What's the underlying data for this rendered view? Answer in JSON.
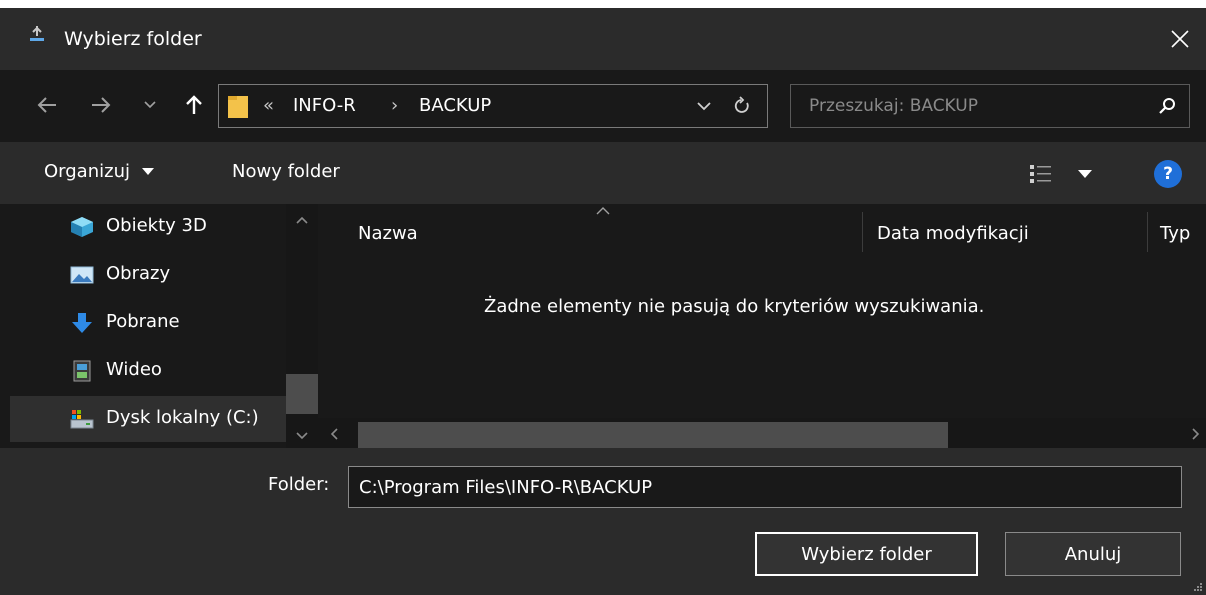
{
  "window": {
    "title": "Wybierz folder",
    "close_glyph": "✕"
  },
  "nav": {
    "back_icon": "arrow-left-icon",
    "forward_icon": "arrow-right-icon",
    "recent_icon": "chevron-down-icon",
    "up_icon": "arrow-up-icon",
    "breadcrumb_prefix": "«",
    "breadcrumb": [
      "INFO-R",
      "BACKUP"
    ],
    "breadcrumb_sep": "›",
    "search_placeholder": "Przeszukaj: BACKUP"
  },
  "toolbar": {
    "organize_label": "Organizuj",
    "new_folder_label": "Nowy folder",
    "help_glyph": "?"
  },
  "sidebar": {
    "items": [
      {
        "label": "Obiekty 3D",
        "icon": "3d-objects-icon"
      },
      {
        "label": "Obrazy",
        "icon": "pictures-icon"
      },
      {
        "label": "Pobrane",
        "icon": "downloads-icon"
      },
      {
        "label": "Wideo",
        "icon": "video-icon"
      },
      {
        "label": "Dysk lokalny (C:)",
        "icon": "local-disk-icon",
        "selected": true
      }
    ]
  },
  "content": {
    "columns": [
      "Nazwa",
      "Data modyfikacji",
      "Typ"
    ],
    "sorted_column_indicator": "^",
    "empty_message": "Żadne elementy nie pasują do kryteriów wyszukiwania."
  },
  "footer": {
    "folder_label": "Folder:",
    "folder_value": "C:\\Program Files\\INFO-R\\BACKUP",
    "select_button": "Wybierz folder",
    "cancel_button": "Anuluj"
  },
  "colors": {
    "background": "#191919",
    "bar": "#2b2b2b",
    "accent_help": "#1f6fd8",
    "folder_yellow": "#f3c24a"
  }
}
